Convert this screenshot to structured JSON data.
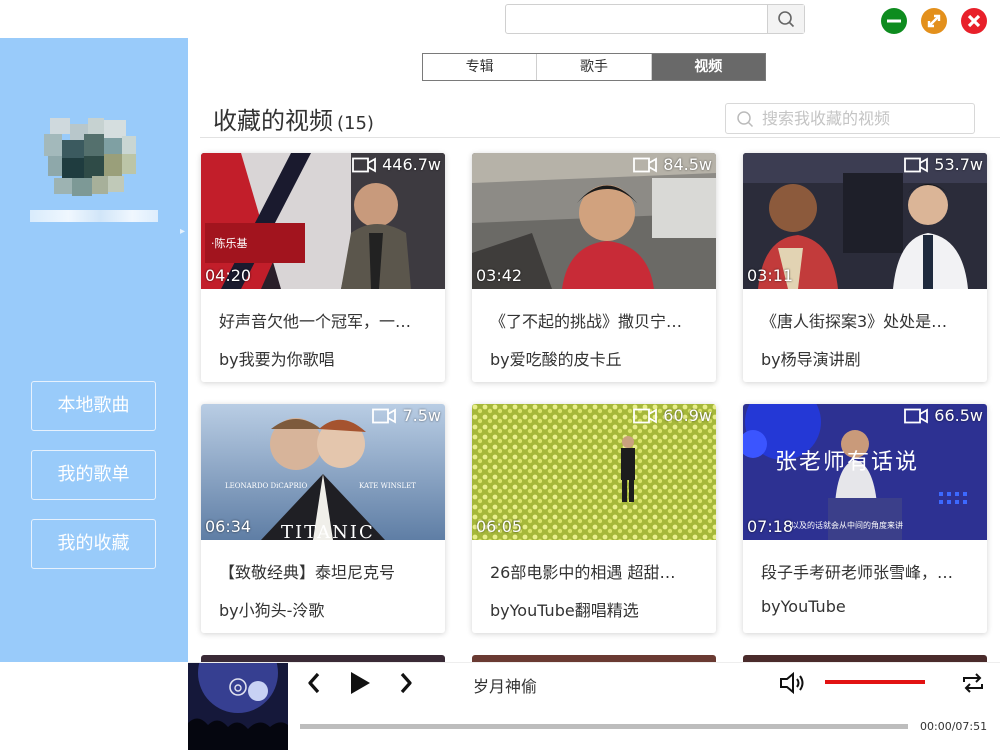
{
  "topbar": {
    "search_value": "",
    "search_icon": "search-icon",
    "window_buttons": [
      {
        "icon": "minimize-icon",
        "color": "#0e8c1f"
      },
      {
        "icon": "maximize-icon",
        "color": "#e3901c"
      },
      {
        "icon": "close-icon",
        "color": "#e8202a"
      }
    ]
  },
  "sidebar": {
    "background": "#99cbfa",
    "nav": [
      {
        "label": "本地歌曲"
      },
      {
        "label": "我的歌单"
      },
      {
        "label": "我的收藏"
      }
    ]
  },
  "tabs": [
    {
      "label": "专辑",
      "active": false
    },
    {
      "label": "歌手",
      "active": false
    },
    {
      "label": "视频",
      "active": true
    }
  ],
  "main": {
    "title": "收藏的视频",
    "count": "(15)",
    "search_placeholder": "搜索我收藏的视频"
  },
  "videos": [
    {
      "views": "446.7w",
      "duration": "04:20",
      "title": "好声音欠他一个冠军，一…",
      "author": "by我要为你歌唱"
    },
    {
      "views": "84.5w",
      "duration": "03:42",
      "title": "《了不起的挑战》撒贝宁…",
      "author": "by爱吃酸的皮卡丘"
    },
    {
      "views": "53.7w",
      "duration": "03:11",
      "title": "《唐人街探案3》处处是…",
      "author": "by杨导演讲剧"
    },
    {
      "views": "7.5w",
      "duration": "06:34",
      "title": "【致敬经典】泰坦尼克号",
      "author": "by小狗头-泠歌",
      "overlay_left": "LEONARDO DiCAPRIO",
      "overlay_right": "KATE WINSLET",
      "overlay_title": "TITANIC"
    },
    {
      "views": "60.9w",
      "duration": "06:05",
      "title": "26部电影中的相遇 超甜…",
      "author": "byYouTube翻唱精选"
    },
    {
      "views": "66.5w",
      "duration": "07:18",
      "title": "段子手考研老师张雪峰，…",
      "author": "byYouTube",
      "overlay_title": "张老师有话说",
      "overlay_caption": "以及的话就会从中间的角度来讲"
    }
  ],
  "player": {
    "song": "岁月神偷",
    "time": "00:00/07:51",
    "progress": 0.0,
    "volume": 1.0,
    "volume_color": "#e21212",
    "icons": [
      "prev-icon",
      "play-icon",
      "next-icon",
      "volume-icon",
      "repeat-icon"
    ]
  }
}
